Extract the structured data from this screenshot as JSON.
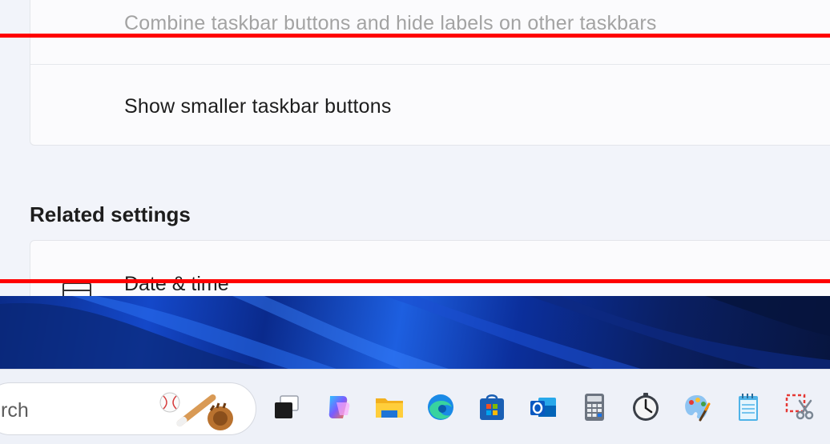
{
  "settings": {
    "combine_other_label": "Combine taskbar buttons and hide labels on other taskbars",
    "smaller_buttons_label": "Show smaller taskbar buttons",
    "related_title": "Related settings",
    "related_items": [
      {
        "label": "Date & time",
        "icon": "calendar-clock-icon"
      }
    ]
  },
  "taskbar": {
    "search_placeholder": "rch",
    "search_art": "baseball-bat-glove-illustration",
    "apps": [
      {
        "name": "task-view-icon"
      },
      {
        "name": "copilot-icon"
      },
      {
        "name": "file-explorer-icon"
      },
      {
        "name": "edge-icon"
      },
      {
        "name": "microsoft-store-icon"
      },
      {
        "name": "outlook-icon"
      },
      {
        "name": "calculator-icon"
      },
      {
        "name": "clock-icon"
      },
      {
        "name": "paint-icon"
      },
      {
        "name": "notepad-icon"
      },
      {
        "name": "snipping-tool-icon"
      }
    ]
  },
  "colors": {
    "annotation_line": "#ff0000",
    "accent_blue": "#1448c9"
  }
}
